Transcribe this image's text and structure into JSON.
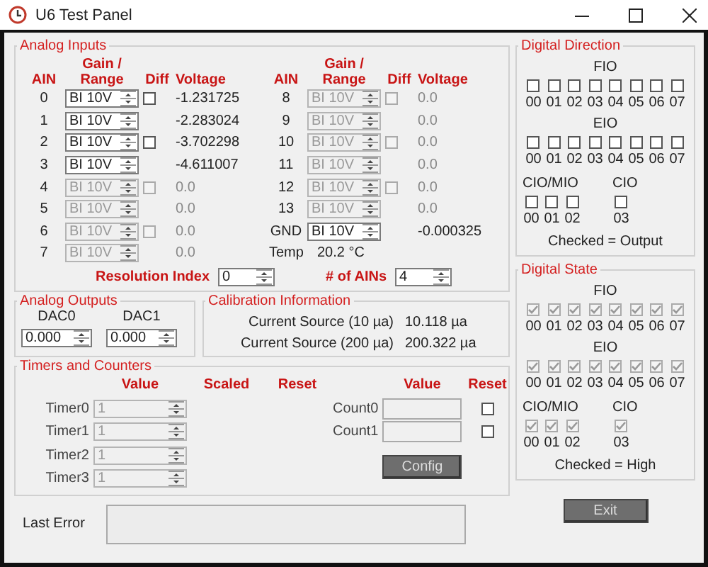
{
  "window": {
    "title": "U6 Test Panel"
  },
  "analog_inputs": {
    "title": "Analog Inputs",
    "left_headers": [
      "AIN",
      "Gain / Range",
      "Diff",
      "Voltage"
    ],
    "right_headers": [
      "AIN",
      "Gain / Range",
      "Diff",
      "Voltage"
    ],
    "left_rows": [
      {
        "ain": "0",
        "range": "BI 10V",
        "disabled": false,
        "diff_checked": false,
        "voltage": "-1.231725"
      },
      {
        "ain": "1",
        "range": "BI 10V",
        "disabled": false,
        "voltage": "-2.283024"
      },
      {
        "ain": "2",
        "range": "BI 10V",
        "disabled": false,
        "diff_checked": false,
        "voltage": "-3.702298"
      },
      {
        "ain": "3",
        "range": "BI 10V",
        "disabled": false,
        "voltage": "-4.611007"
      },
      {
        "ain": "4",
        "range": "BI 10V",
        "disabled": true,
        "diff_checked": false,
        "voltage": "0.0"
      },
      {
        "ain": "5",
        "range": "BI 10V",
        "disabled": true,
        "voltage": "0.0"
      },
      {
        "ain": "6",
        "range": "BI 10V",
        "disabled": true,
        "diff_checked": false,
        "voltage": "0.0"
      },
      {
        "ain": "7",
        "range": "BI 10V",
        "disabled": true,
        "voltage": "0.0"
      }
    ],
    "right_rows": [
      {
        "ain": "8",
        "range": "BI 10V",
        "disabled": true,
        "diff_checked": false,
        "voltage": "0.0"
      },
      {
        "ain": "9",
        "range": "BI 10V",
        "disabled": true,
        "voltage": "0.0"
      },
      {
        "ain": "10",
        "range": "BI 10V",
        "disabled": true,
        "diff_checked": false,
        "voltage": "0.0"
      },
      {
        "ain": "11",
        "range": "BI 10V",
        "disabled": true,
        "voltage": "0.0"
      },
      {
        "ain": "12",
        "range": "BI 10V",
        "disabled": true,
        "diff_checked": false,
        "voltage": "0.0"
      },
      {
        "ain": "13",
        "range": "BI 10V",
        "disabled": true,
        "voltage": "0.0"
      },
      {
        "ain": "GND",
        "range": "BI 10V",
        "disabled": false,
        "voltage": "-0.000325"
      }
    ],
    "temp": {
      "label": "Temp",
      "value": "20.2 °C"
    },
    "resolution": {
      "label": "Resolution Index",
      "value": "0"
    },
    "num_ains": {
      "label": "# of AINs",
      "value": "4"
    }
  },
  "analog_outputs": {
    "title": "Analog Outputs",
    "dacs": [
      {
        "label": "DAC0",
        "value": "0.000"
      },
      {
        "label": "DAC1",
        "value": "0.000"
      }
    ]
  },
  "calibration": {
    "title": "Calibration Information",
    "rows": [
      {
        "label": "Current Source (10 µa)",
        "value": "10.118 µa"
      },
      {
        "label": "Current Source (200 µa)",
        "value": "200.322 µa"
      }
    ]
  },
  "timers_counters": {
    "title": "Timers and Counters",
    "timer_headers": [
      "Value",
      "Scaled",
      "Reset"
    ],
    "counter_headers": [
      "Value",
      "Reset"
    ],
    "timers": [
      {
        "label": "Timer0",
        "value": "1",
        "disabled": true
      },
      {
        "label": "Timer1",
        "value": "1",
        "disabled": true
      },
      {
        "label": "Timer2",
        "value": "1",
        "disabled": true
      },
      {
        "label": "Timer3",
        "value": "1",
        "disabled": true
      }
    ],
    "counters": [
      {
        "label": "Count0",
        "disabled": true,
        "reset_checked": false
      },
      {
        "label": "Count1",
        "disabled": true,
        "reset_checked": false
      }
    ],
    "config_button": "Config"
  },
  "last_error": {
    "label": "Last Error"
  },
  "exit_button": "Exit",
  "digital": [
    {
      "title": "Digital Direction",
      "disabled": false,
      "footer": "Checked = Output",
      "ports": [
        {
          "name": "FIO",
          "bits": [
            {
              "label": "00",
              "checked": false
            },
            {
              "label": "01",
              "checked": false
            },
            {
              "label": "02",
              "checked": false
            },
            {
              "label": "03",
              "checked": false
            },
            {
              "label": "04",
              "checked": false
            },
            {
              "label": "05",
              "checked": false
            },
            {
              "label": "06",
              "checked": false
            },
            {
              "label": "07",
              "checked": false
            }
          ]
        },
        {
          "name": "EIO",
          "bits": [
            {
              "label": "00",
              "checked": false
            },
            {
              "label": "01",
              "checked": false
            },
            {
              "label": "02",
              "checked": false
            },
            {
              "label": "03",
              "checked": false
            },
            {
              "label": "04",
              "checked": false
            },
            {
              "label": "05",
              "checked": false
            },
            {
              "label": "06",
              "checked": false
            },
            {
              "label": "07",
              "checked": false
            }
          ]
        }
      ],
      "sub_ports": [
        {
          "name": "CIO/MIO",
          "bits": [
            {
              "label": "00",
              "checked": false
            },
            {
              "label": "01",
              "checked": false
            },
            {
              "label": "02",
              "checked": false
            }
          ]
        },
        {
          "name": "CIO",
          "bits": [
            {
              "label": "03",
              "checked": false
            }
          ]
        }
      ]
    },
    {
      "title": "Digital State",
      "disabled": true,
      "footer": "Checked = High",
      "ports": [
        {
          "name": "FIO",
          "bits": [
            {
              "label": "00",
              "checked": true
            },
            {
              "label": "01",
              "checked": true
            },
            {
              "label": "02",
              "checked": true
            },
            {
              "label": "03",
              "checked": true
            },
            {
              "label": "04",
              "checked": true
            },
            {
              "label": "05",
              "checked": true
            },
            {
              "label": "06",
              "checked": true
            },
            {
              "label": "07",
              "checked": true
            }
          ]
        },
        {
          "name": "EIO",
          "bits": [
            {
              "label": "00",
              "checked": true
            },
            {
              "label": "01",
              "checked": true
            },
            {
              "label": "02",
              "checked": true
            },
            {
              "label": "03",
              "checked": true
            },
            {
              "label": "04",
              "checked": true
            },
            {
              "label": "05",
              "checked": true
            },
            {
              "label": "06",
              "checked": true
            },
            {
              "label": "07",
              "checked": true
            }
          ]
        }
      ],
      "sub_ports": [
        {
          "name": "CIO/MIO",
          "bits": [
            {
              "label": "00",
              "checked": true
            },
            {
              "label": "01",
              "checked": true
            },
            {
              "label": "02",
              "checked": true
            }
          ]
        },
        {
          "name": "CIO",
          "bits": [
            {
              "label": "03",
              "checked": true
            }
          ]
        }
      ]
    }
  ]
}
